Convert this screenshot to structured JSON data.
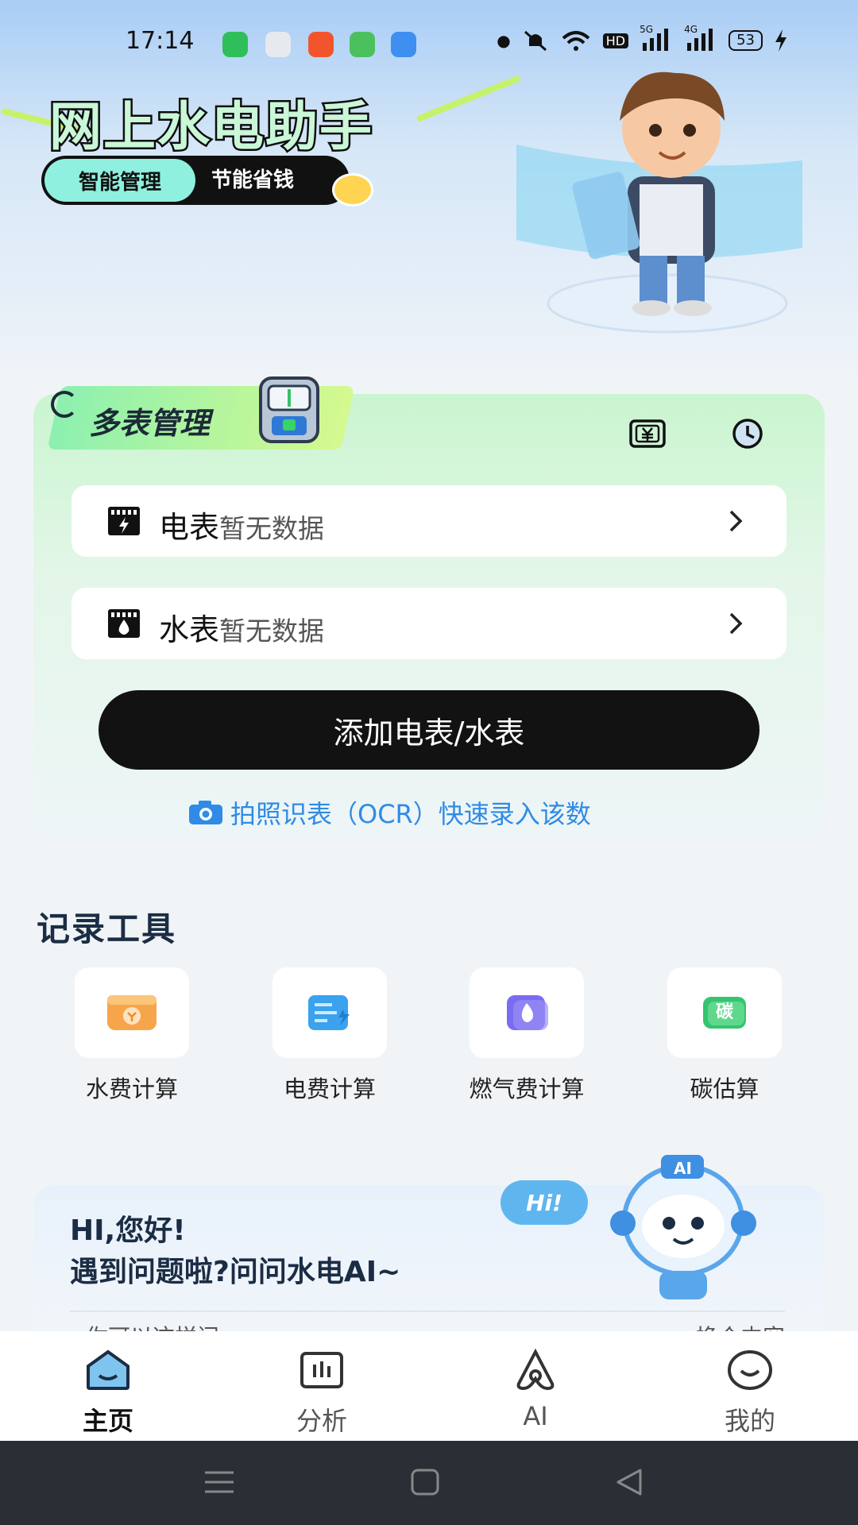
{
  "status_bar": {
    "time": "17:14",
    "network_labels": [
      "HD",
      "5G",
      "4G"
    ],
    "battery": "53"
  },
  "hero": {
    "title": "网上水电助手",
    "tag_left": "智能管理",
    "tag_right": "节能省钱"
  },
  "meter_card": {
    "title": "多表管理",
    "rows": [
      {
        "label": "电表",
        "status": "暂无数据"
      },
      {
        "label": "水表",
        "status": "暂无数据"
      }
    ],
    "add_button": "添加电表/水表",
    "ocr_link": "拍照识表（OCR）快速录入该数"
  },
  "tools": {
    "title": "记录工具",
    "items": [
      {
        "label": "水费计算",
        "icon": "water-fee-icon",
        "color": "#f7a54a"
      },
      {
        "label": "电费计算",
        "icon": "electric-fee-icon",
        "color": "#3aa2ee"
      },
      {
        "label": "燃气费计算",
        "icon": "gas-fee-icon",
        "color": "#7a6cf0"
      },
      {
        "label": "碳估算",
        "icon": "carbon-icon",
        "color": "#36c46f",
        "icon_text": "碳"
      }
    ]
  },
  "ai_card": {
    "greeting": "HI,您好!",
    "question": "遇到问题啦?问问水电AI~",
    "bubble": "Hi!",
    "robot_badge": "AI",
    "hint_left": "你可以这样问",
    "hint_right": "换个内容"
  },
  "tabbar": {
    "tabs": [
      {
        "label": "主页",
        "active": true
      },
      {
        "label": "分析",
        "active": false
      },
      {
        "label": "AI",
        "active": false
      },
      {
        "label": "我的",
        "active": false
      }
    ]
  }
}
